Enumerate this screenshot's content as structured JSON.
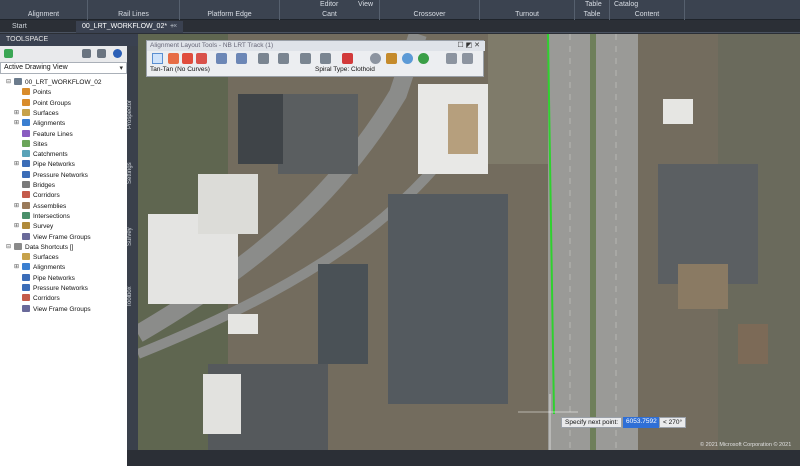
{
  "ribbon": {
    "panels": [
      "Alignment",
      "Rail Lines",
      "Platform Edge",
      "Cant",
      "Crossover",
      "Turnout",
      "Table",
      "Content"
    ],
    "sub_labels": [
      "Editor",
      "View",
      "Table",
      "Catalog"
    ]
  },
  "tabs": [
    {
      "label": "Start"
    },
    {
      "label": "00_LRT_WORKFLOW_02*",
      "close": "×"
    },
    {
      "label": "+"
    }
  ],
  "toolspace": {
    "title": "TOOLSPACE",
    "view_selector": "Active Drawing View",
    "side_tabs": [
      "Prospector",
      "Settings",
      "Survey",
      "Toolbox"
    ],
    "tree": [
      {
        "label": "00_LRT_WORKFLOW_02",
        "level": 0,
        "expander": "⊟",
        "icon": "drawing"
      },
      {
        "label": "Points",
        "level": 1,
        "expander": "",
        "icon": "points"
      },
      {
        "label": "Point Groups",
        "level": 1,
        "expander": "",
        "icon": "points"
      },
      {
        "label": "Surfaces",
        "level": 1,
        "expander": "⊞",
        "icon": "surface"
      },
      {
        "label": "Alignments",
        "level": 1,
        "expander": "⊞",
        "icon": "alignment"
      },
      {
        "label": "Feature Lines",
        "level": 1,
        "expander": "",
        "icon": "feature"
      },
      {
        "label": "Sites",
        "level": 1,
        "expander": "",
        "icon": "site"
      },
      {
        "label": "Catchments",
        "level": 1,
        "expander": "",
        "icon": "catch"
      },
      {
        "label": "Pipe Networks",
        "level": 1,
        "expander": "⊞",
        "icon": "pipe"
      },
      {
        "label": "Pressure Networks",
        "level": 1,
        "expander": "",
        "icon": "pipe"
      },
      {
        "label": "Bridges",
        "level": 1,
        "expander": "",
        "icon": "bridge"
      },
      {
        "label": "Corridors",
        "level": 1,
        "expander": "",
        "icon": "corridor"
      },
      {
        "label": "Assemblies",
        "level": 1,
        "expander": "⊞",
        "icon": "assembly"
      },
      {
        "label": "Intersections",
        "level": 1,
        "expander": "",
        "icon": "intersection"
      },
      {
        "label": "Survey",
        "level": 1,
        "expander": "⊞",
        "icon": "survey"
      },
      {
        "label": "View Frame Groups",
        "level": 1,
        "expander": "",
        "icon": "frame"
      },
      {
        "label": "Data Shortcuts []",
        "level": 0,
        "expander": "⊟",
        "icon": "shortcut"
      },
      {
        "label": "Surfaces",
        "level": 1,
        "expander": "",
        "icon": "surface"
      },
      {
        "label": "Alignments",
        "level": 1,
        "expander": "⊞",
        "icon": "alignment"
      },
      {
        "label": "Pipe Networks",
        "level": 1,
        "expander": "",
        "icon": "pipe"
      },
      {
        "label": "Pressure Networks",
        "level": 1,
        "expander": "",
        "icon": "pipe"
      },
      {
        "label": "Corridors",
        "level": 1,
        "expander": "",
        "icon": "corridor"
      },
      {
        "label": "View Frame Groups",
        "level": 1,
        "expander": "",
        "icon": "frame"
      }
    ]
  },
  "alignment_tools": {
    "title": "Alignment Layout Tools - NB LRT Track (1)",
    "window_controls": "☐ ◩ ✕",
    "curve_mode": "Tan-Tan (No Curves)",
    "spiral_type": "Spiral Type: Clothoid"
  },
  "command_prompt": {
    "label": "Specify next point:",
    "value": "6053.7592",
    "angle": "< 270°"
  },
  "copyright": "© 2021 Microsoft Corporation © 2021",
  "colors": {
    "ribbon_bg": "#3b4350",
    "alignment_line": "#2fd12f",
    "selection_blue": "#2f6fd6"
  }
}
